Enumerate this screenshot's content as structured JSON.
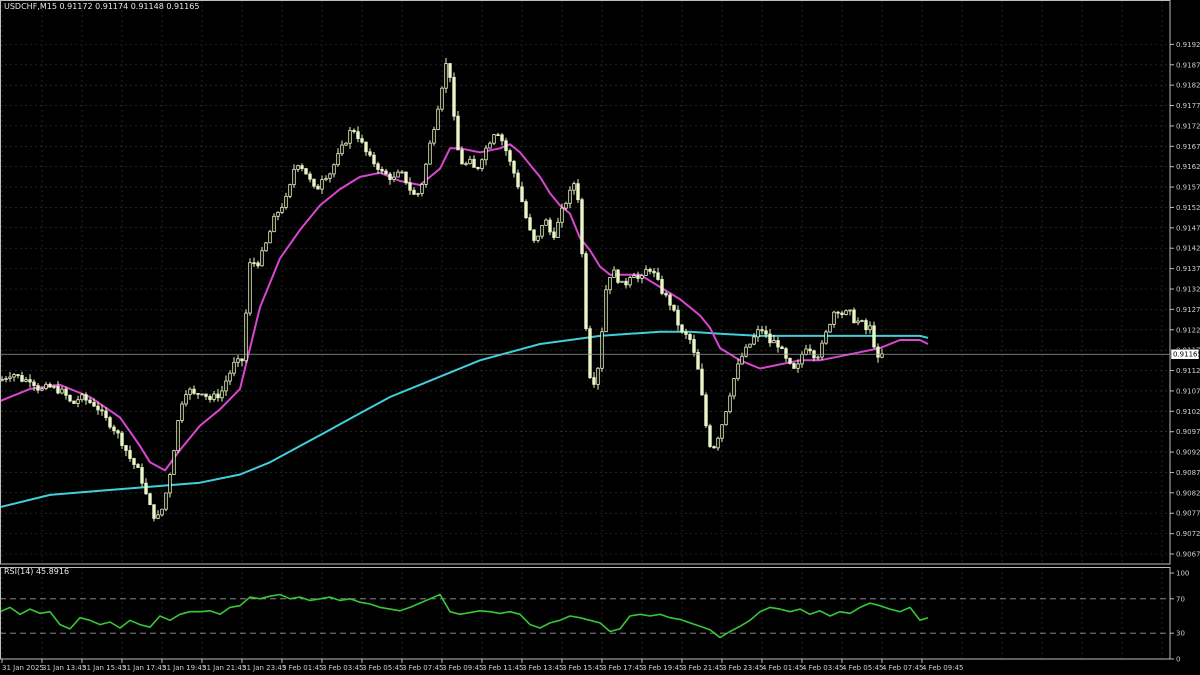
{
  "header": {
    "symbol_info": "USDCHF,M15  0.91172 0.91174 0.91148 0.91165",
    "rsi_info": "RSI(14) 45.8916"
  },
  "price_label": "0.91165",
  "colors": {
    "background": "#000000",
    "grid": "#3a3a3a",
    "candle": "#e9f7c8",
    "ma_fast": "#d946d0",
    "ma_slow": "#3fd0dc",
    "rsi": "#37c837",
    "axis_text": "#cfcfcf"
  },
  "chart_data": [
    {
      "type": "candlestick",
      "title": "USDCHF,M15",
      "ylim": [
        0.90675,
        0.91975
      ],
      "y_ticks": [
        "0.91925",
        "0.91875",
        "0.91825",
        "0.91775",
        "0.91725",
        "0.91675",
        "0.91625",
        "0.91575",
        "0.91525",
        "0.91475",
        "0.91425",
        "0.91375",
        "0.91325",
        "0.91275",
        "0.91225",
        "0.91175",
        "0.91125",
        "0.91075",
        "0.91025",
        "0.90975",
        "0.90925",
        "0.90875",
        "0.90825",
        "0.90775",
        "0.90725",
        "0.90675"
      ],
      "x_ticks": [
        "31 Jan 2025",
        "31 Jan 13:45",
        "31 Jan 15:45",
        "31 Jan 17:45",
        "31 Jan 19:45",
        "31 Jan 21:45",
        "31 Jan 23:45",
        "3 Feb 01:45",
        "3 Feb 03:45",
        "3 Feb 05:45",
        "3 Feb 07:45",
        "3 Feb 09:45",
        "3 Feb 11:45",
        "3 Feb 13:45",
        "3 Feb 15:45",
        "3 Feb 17:45",
        "3 Feb 19:45",
        "3 Feb 21:45",
        "3 Feb 23:45",
        "4 Feb 01:45",
        "4 Feb 03:45",
        "4 Feb 05:45",
        "4 Feb 07:45",
        "4 Feb 09:45"
      ],
      "path_x": [
        0,
        6,
        12,
        18,
        24,
        30,
        36,
        40,
        48,
        56,
        64,
        72,
        80,
        88,
        96,
        104,
        112,
        120,
        126,
        132,
        136,
        140,
        144,
        148,
        152,
        156,
        160,
        164,
        168,
        172,
        176,
        180,
        184,
        188,
        192,
        196,
        200,
        204,
        208,
        212,
        216,
        220,
        224,
        228,
        232,
        236,
        240,
        244,
        248,
        252,
        256,
        260,
        264,
        268,
        272,
        276,
        280,
        284,
        288,
        292,
        296,
        300,
        304,
        308,
        312,
        316,
        320,
        324,
        328,
        332,
        336,
        340,
        344,
        348,
        352,
        356,
        360,
        364,
        368,
        372,
        376,
        380,
        384,
        388,
        392,
        396,
        400,
        404,
        408,
        412,
        416,
        420,
        424,
        428,
        432,
        436,
        440,
        444,
        448,
        452,
        456,
        460,
        464,
        468,
        472,
        476,
        480,
        484,
        488,
        492,
        496,
        500,
        504,
        508,
        512,
        516,
        520,
        524,
        528,
        532,
        536,
        540,
        544,
        548,
        552,
        556,
        560,
        564,
        568,
        572,
        576,
        580,
        584,
        588,
        592,
        596,
        600,
        604,
        608,
        612,
        616,
        620,
        624,
        628,
        632,
        636,
        640,
        644,
        648,
        652,
        656,
        660,
        664,
        668,
        672,
        676,
        680,
        684,
        688,
        692,
        696,
        700,
        704,
        708,
        712,
        716,
        720,
        724,
        728,
        732,
        736,
        740,
        744,
        748,
        752,
        756,
        760,
        764,
        768,
        772,
        776,
        780,
        784,
        788,
        792,
        796,
        800,
        804,
        808,
        812,
        816,
        820,
        824,
        828,
        832,
        836,
        840,
        844,
        848,
        852,
        856,
        860,
        864,
        868,
        872,
        876,
        880,
        884,
        888,
        892,
        896,
        900,
        904,
        908,
        912,
        916,
        920,
        924,
        928
      ],
      "path_y": [
        0.911,
        0.9111,
        0.9112,
        0.9111,
        0.911,
        0.91105,
        0.9109,
        0.91075,
        0.91085,
        0.9108,
        0.9107,
        0.9104,
        0.9106,
        0.9105,
        0.9104,
        0.9101,
        0.9099,
        0.9096,
        0.9093,
        0.909,
        0.9089,
        0.9087,
        0.9084,
        0.908,
        0.9078,
        0.9076,
        0.9077,
        0.908,
        0.9085,
        0.909,
        0.9097,
        0.9103,
        0.9107,
        0.9108,
        0.9107,
        0.9106,
        0.9108,
        0.9107,
        0.9106,
        0.9105,
        0.9107,
        0.9106,
        0.9109,
        0.9111,
        0.9113,
        0.9115,
        0.9114,
        0.9116,
        0.9137,
        0.914,
        0.9138,
        0.914,
        0.9142,
        0.9145,
        0.9148,
        0.9151,
        0.9152,
        0.9154,
        0.9155,
        0.916,
        0.9164,
        0.9163,
        0.9162,
        0.916,
        0.9158,
        0.9156,
        0.9159,
        0.9161,
        0.916,
        0.9162,
        0.9164,
        0.9166,
        0.9168,
        0.917,
        0.9172,
        0.9171,
        0.9169,
        0.9167,
        0.9165,
        0.9164,
        0.9163,
        0.9162,
        0.916,
        0.9161,
        0.9159,
        0.916,
        0.9161,
        0.916,
        0.9158,
        0.9156,
        0.9155,
        0.9157,
        0.916,
        0.9166,
        0.917,
        0.9175,
        0.918,
        0.9185,
        0.919,
        0.918,
        0.9168,
        0.9165,
        0.9162,
        0.9164,
        0.9163,
        0.9161,
        0.9164,
        0.9166,
        0.9168,
        0.917,
        0.9172,
        0.917,
        0.9168,
        0.9165,
        0.9162,
        0.916,
        0.9156,
        0.9152,
        0.9148,
        0.9145,
        0.9143,
        0.9147,
        0.915,
        0.9148,
        0.9145,
        0.9147,
        0.915,
        0.9153,
        0.9155,
        0.9157,
        0.916,
        0.915,
        0.9132,
        0.9115,
        0.9108,
        0.9112,
        0.9115,
        0.913,
        0.9135,
        0.9137,
        0.9136,
        0.9134,
        0.9133,
        0.9135,
        0.9137,
        0.9136,
        0.9134,
        0.9136,
        0.9138,
        0.9137,
        0.9135,
        0.9133,
        0.9131,
        0.913,
        0.9128,
        0.9125,
        0.9123,
        0.912,
        0.9122,
        0.9118,
        0.9115,
        0.911,
        0.9102,
        0.9096,
        0.9093,
        0.9095,
        0.9098,
        0.9101,
        0.9105,
        0.9109,
        0.9112,
        0.9115,
        0.9117,
        0.9118,
        0.912,
        0.9121,
        0.9123,
        0.9122,
        0.912,
        0.9119,
        0.912,
        0.9118,
        0.9116,
        0.9114,
        0.9113,
        0.9112,
        0.9115,
        0.9118,
        0.9119,
        0.9117,
        0.9116,
        0.9117,
        0.912,
        0.9123,
        0.9126,
        0.9128,
        0.9127,
        0.9126,
        0.9127,
        0.9126,
        0.9124,
        0.9125,
        0.9123,
        0.9122,
        0.9124,
        0.9114,
        0.9116,
        0.91165
      ],
      "ma_fast": {
        "x": [
          0,
          30,
          60,
          90,
          120,
          140,
          150,
          165,
          180,
          200,
          220,
          240,
          260,
          280,
          300,
          320,
          340,
          360,
          380,
          400,
          420,
          440,
          450,
          460,
          480,
          500,
          510,
          520,
          530,
          540,
          550,
          560,
          570,
          580,
          590,
          600,
          610,
          620,
          640,
          660,
          680,
          700,
          710,
          720,
          740,
          760,
          780,
          800,
          820,
          840,
          860,
          880,
          900,
          920,
          928
        ],
        "y": [
          0.9105,
          0.9108,
          0.9109,
          0.9106,
          0.9101,
          0.9094,
          0.909,
          0.9088,
          0.9093,
          0.9099,
          0.9103,
          0.9108,
          0.9128,
          0.914,
          0.9147,
          0.9153,
          0.9157,
          0.916,
          0.9161,
          0.9159,
          0.9158,
          0.9162,
          0.9167,
          0.9167,
          0.9166,
          0.9167,
          0.9168,
          0.9166,
          0.9163,
          0.916,
          0.9156,
          0.9153,
          0.9151,
          0.9145,
          0.9142,
          0.9138,
          0.9136,
          0.9136,
          0.9136,
          0.9133,
          0.913,
          0.9126,
          0.9123,
          0.9118,
          0.9115,
          0.9113,
          0.9114,
          0.9115,
          0.9115,
          0.9116,
          0.9117,
          0.9118,
          0.912,
          0.912,
          0.9119
        ]
      },
      "ma_slow": {
        "x": [
          0,
          50,
          100,
          150,
          200,
          240,
          270,
          300,
          330,
          360,
          390,
          420,
          450,
          480,
          510,
          540,
          570,
          600,
          630,
          660,
          690,
          720,
          760,
          800,
          840,
          880,
          920,
          928
        ],
        "y": [
          0.9079,
          0.9082,
          0.9083,
          0.9084,
          0.9085,
          0.9087,
          0.909,
          0.9094,
          0.9098,
          0.9102,
          0.9106,
          0.9109,
          0.9112,
          0.9115,
          0.9117,
          0.9119,
          0.912,
          0.9121,
          0.91215,
          0.9122,
          0.9122,
          0.91215,
          0.9121,
          0.9121,
          0.9121,
          0.9121,
          0.9121,
          0.91205
        ]
      }
    },
    {
      "type": "line",
      "title": "RSI(14) 45.8916",
      "ylim": [
        0,
        100
      ],
      "y_ticks": [
        "100",
        "70",
        "30",
        "0"
      ],
      "levels": [
        70,
        30
      ],
      "x": [
        0,
        10,
        20,
        30,
        40,
        50,
        60,
        70,
        80,
        90,
        100,
        110,
        120,
        130,
        140,
        150,
        160,
        170,
        180,
        190,
        200,
        210,
        220,
        230,
        240,
        250,
        260,
        270,
        280,
        290,
        300,
        310,
        320,
        330,
        340,
        350,
        360,
        370,
        380,
        390,
        400,
        410,
        420,
        430,
        440,
        450,
        460,
        470,
        480,
        490,
        500,
        510,
        520,
        530,
        540,
        550,
        560,
        570,
        580,
        590,
        600,
        610,
        620,
        630,
        640,
        650,
        660,
        670,
        680,
        690,
        700,
        710,
        720,
        730,
        740,
        750,
        760,
        770,
        780,
        790,
        800,
        810,
        820,
        830,
        840,
        850,
        860,
        870,
        880,
        890,
        900,
        910,
        920,
        928
      ],
      "y": [
        55,
        60,
        52,
        58,
        53,
        55,
        40,
        35,
        48,
        45,
        40,
        43,
        36,
        45,
        40,
        37,
        50,
        45,
        52,
        55,
        55,
        56,
        52,
        60,
        62,
        72,
        70,
        73,
        75,
        70,
        72,
        68,
        70,
        72,
        68,
        70,
        66,
        64,
        60,
        58,
        56,
        60,
        65,
        70,
        75,
        55,
        52,
        54,
        56,
        55,
        53,
        55,
        52,
        40,
        36,
        42,
        45,
        50,
        48,
        45,
        42,
        32,
        35,
        50,
        52,
        50,
        52,
        48,
        46,
        42,
        38,
        34,
        25,
        32,
        38,
        45,
        55,
        60,
        58,
        55,
        58,
        52,
        56,
        50,
        55,
        53,
        60,
        65,
        62,
        58,
        55,
        60,
        45,
        48
      ]
    }
  ]
}
